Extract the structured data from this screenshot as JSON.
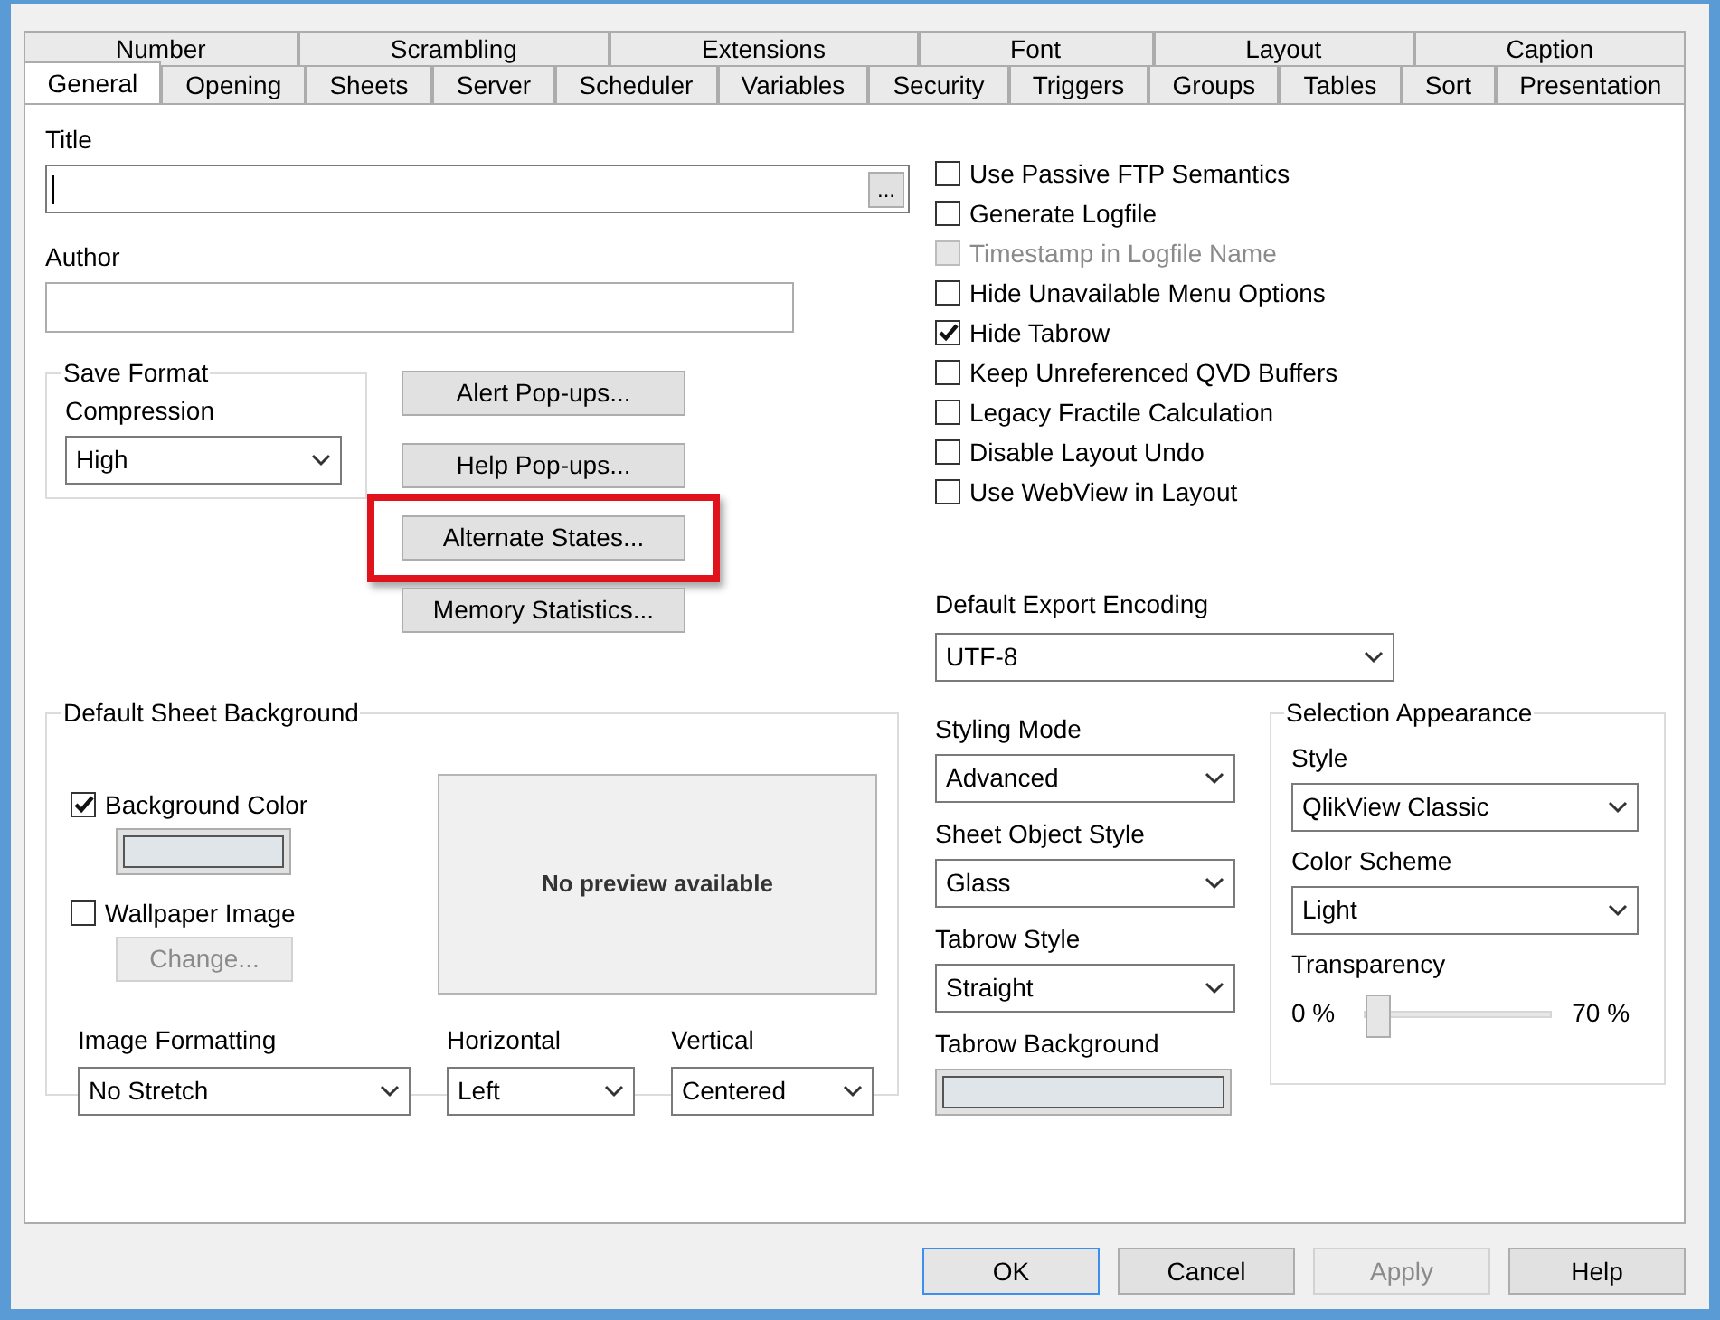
{
  "tabs": {
    "back_row": [
      {
        "label": "Number",
        "selected": false
      },
      {
        "label": "Scrambling",
        "selected": false
      },
      {
        "label": "Extensions",
        "selected": false
      },
      {
        "label": "Font",
        "selected": false
      },
      {
        "label": "Layout",
        "selected": false
      },
      {
        "label": "Caption",
        "selected": false
      }
    ],
    "front_row": [
      {
        "label": "General",
        "selected": true
      },
      {
        "label": "Opening",
        "selected": false
      },
      {
        "label": "Sheets",
        "selected": false
      },
      {
        "label": "Server",
        "selected": false
      },
      {
        "label": "Scheduler",
        "selected": false
      },
      {
        "label": "Variables",
        "selected": false
      },
      {
        "label": "Security",
        "selected": false
      },
      {
        "label": "Triggers",
        "selected": false
      },
      {
        "label": "Groups",
        "selected": false
      },
      {
        "label": "Tables",
        "selected": false
      },
      {
        "label": "Sort",
        "selected": false
      },
      {
        "label": "Presentation",
        "selected": false
      }
    ]
  },
  "title_field": {
    "label": "Title",
    "browse_button": "..."
  },
  "author_field": {
    "label": "Author"
  },
  "save_format": {
    "title": "Save Format",
    "compression_label": "Compression",
    "compression": "High"
  },
  "buttons": [
    {
      "label": "Alert Pop-ups...",
      "highlighted": false
    },
    {
      "label": "Help Pop-ups...",
      "highlighted": false
    },
    {
      "label": "Alternate States...",
      "highlighted": true
    },
    {
      "label": "Memory Statistics...",
      "highlighted": false
    }
  ],
  "options": [
    {
      "label": "Use Passive FTP Semantics",
      "checked": false,
      "disabled": false
    },
    {
      "label": "Generate Logfile",
      "checked": false,
      "disabled": false
    },
    {
      "label": "Timestamp in Logfile Name",
      "checked": false,
      "disabled": true
    },
    {
      "label": "Hide Unavailable Menu Options",
      "checked": false,
      "disabled": false
    },
    {
      "label": "Hide Tabrow",
      "checked": true,
      "disabled": false
    },
    {
      "label": "Keep Unreferenced QVD Buffers",
      "checked": false,
      "disabled": false
    },
    {
      "label": "Legacy Fractile Calculation",
      "checked": false,
      "disabled": false
    },
    {
      "label": "Disable Layout Undo",
      "checked": false,
      "disabled": false
    },
    {
      "label": "Use WebView in Layout",
      "checked": false,
      "disabled": false
    }
  ],
  "export_encoding": {
    "label": "Default Export Encoding",
    "value": "UTF-8"
  },
  "sheet_background": {
    "title": "Default Sheet Background",
    "background_color": {
      "label": "Background Color",
      "checked": true
    },
    "wallpaper": {
      "label": "Wallpaper Image",
      "checked": false,
      "button": "Change...",
      "button_disabled": true
    },
    "preview_text": "No preview available",
    "formatting": [
      {
        "label": "Image Formatting",
        "value": "No Stretch"
      },
      {
        "label": "Horizontal",
        "value": "Left"
      },
      {
        "label": "Vertical",
        "value": "Centered"
      }
    ]
  },
  "styling": [
    {
      "kind": "select",
      "label": "Styling Mode",
      "value": "Advanced"
    },
    {
      "kind": "select",
      "label": "Sheet Object Style",
      "value": "Glass"
    },
    {
      "kind": "select",
      "label": "Tabrow Style",
      "value": "Straight"
    },
    {
      "kind": "swatch",
      "label": "Tabrow Background"
    }
  ],
  "selection_appearance": {
    "title": "Selection Appearance",
    "style_label": "Style",
    "style": "QlikView Classic",
    "scheme_label": "Color Scheme",
    "scheme": "Light",
    "transparency_label": "Transparency",
    "min_label": "0 %",
    "max_label": "70 %",
    "level": 0
  },
  "footer": [
    {
      "label": "OK",
      "default": true,
      "disabled": false
    },
    {
      "label": "Cancel",
      "default": false,
      "disabled": false
    },
    {
      "label": "Apply",
      "default": false,
      "disabled": true
    },
    {
      "label": "Help",
      "default": false,
      "disabled": false
    }
  ]
}
